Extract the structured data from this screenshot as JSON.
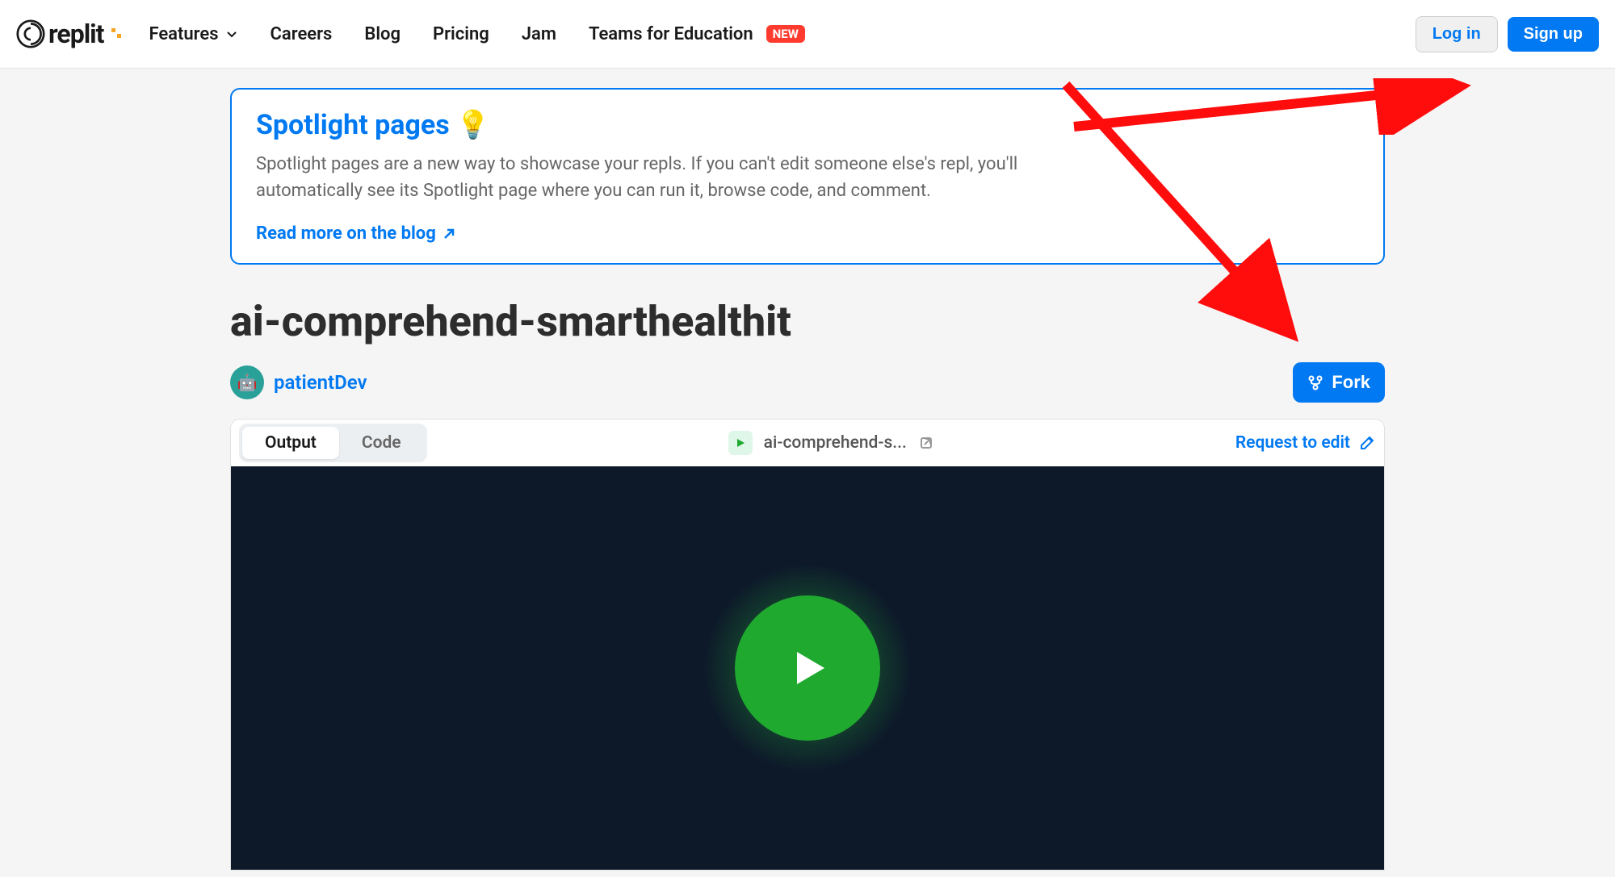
{
  "header": {
    "logo_text": "replit",
    "nav": {
      "features": "Features",
      "careers": "Careers",
      "blog": "Blog",
      "pricing": "Pricing",
      "jam": "Jam",
      "teams": "Teams for Education",
      "new_badge": "NEW"
    },
    "login": "Log in",
    "signup": "Sign up"
  },
  "banner": {
    "title": "Spotlight pages",
    "emoji": "💡",
    "description": "Spotlight pages are a new way to showcase your repls. If you can't edit someone else's repl, you'll automatically see its Spotlight page where you can run it, browse code, and comment.",
    "link_text": "Read more on the blog"
  },
  "repl": {
    "title": "ai-comprehend-smarthealthit",
    "author": "patientDev",
    "avatar_emoji": "🤖",
    "fork_label": "Fork"
  },
  "panel": {
    "tab_output": "Output",
    "tab_code": "Code",
    "file_name": "ai-comprehend-s...",
    "request_edit": "Request to edit"
  }
}
